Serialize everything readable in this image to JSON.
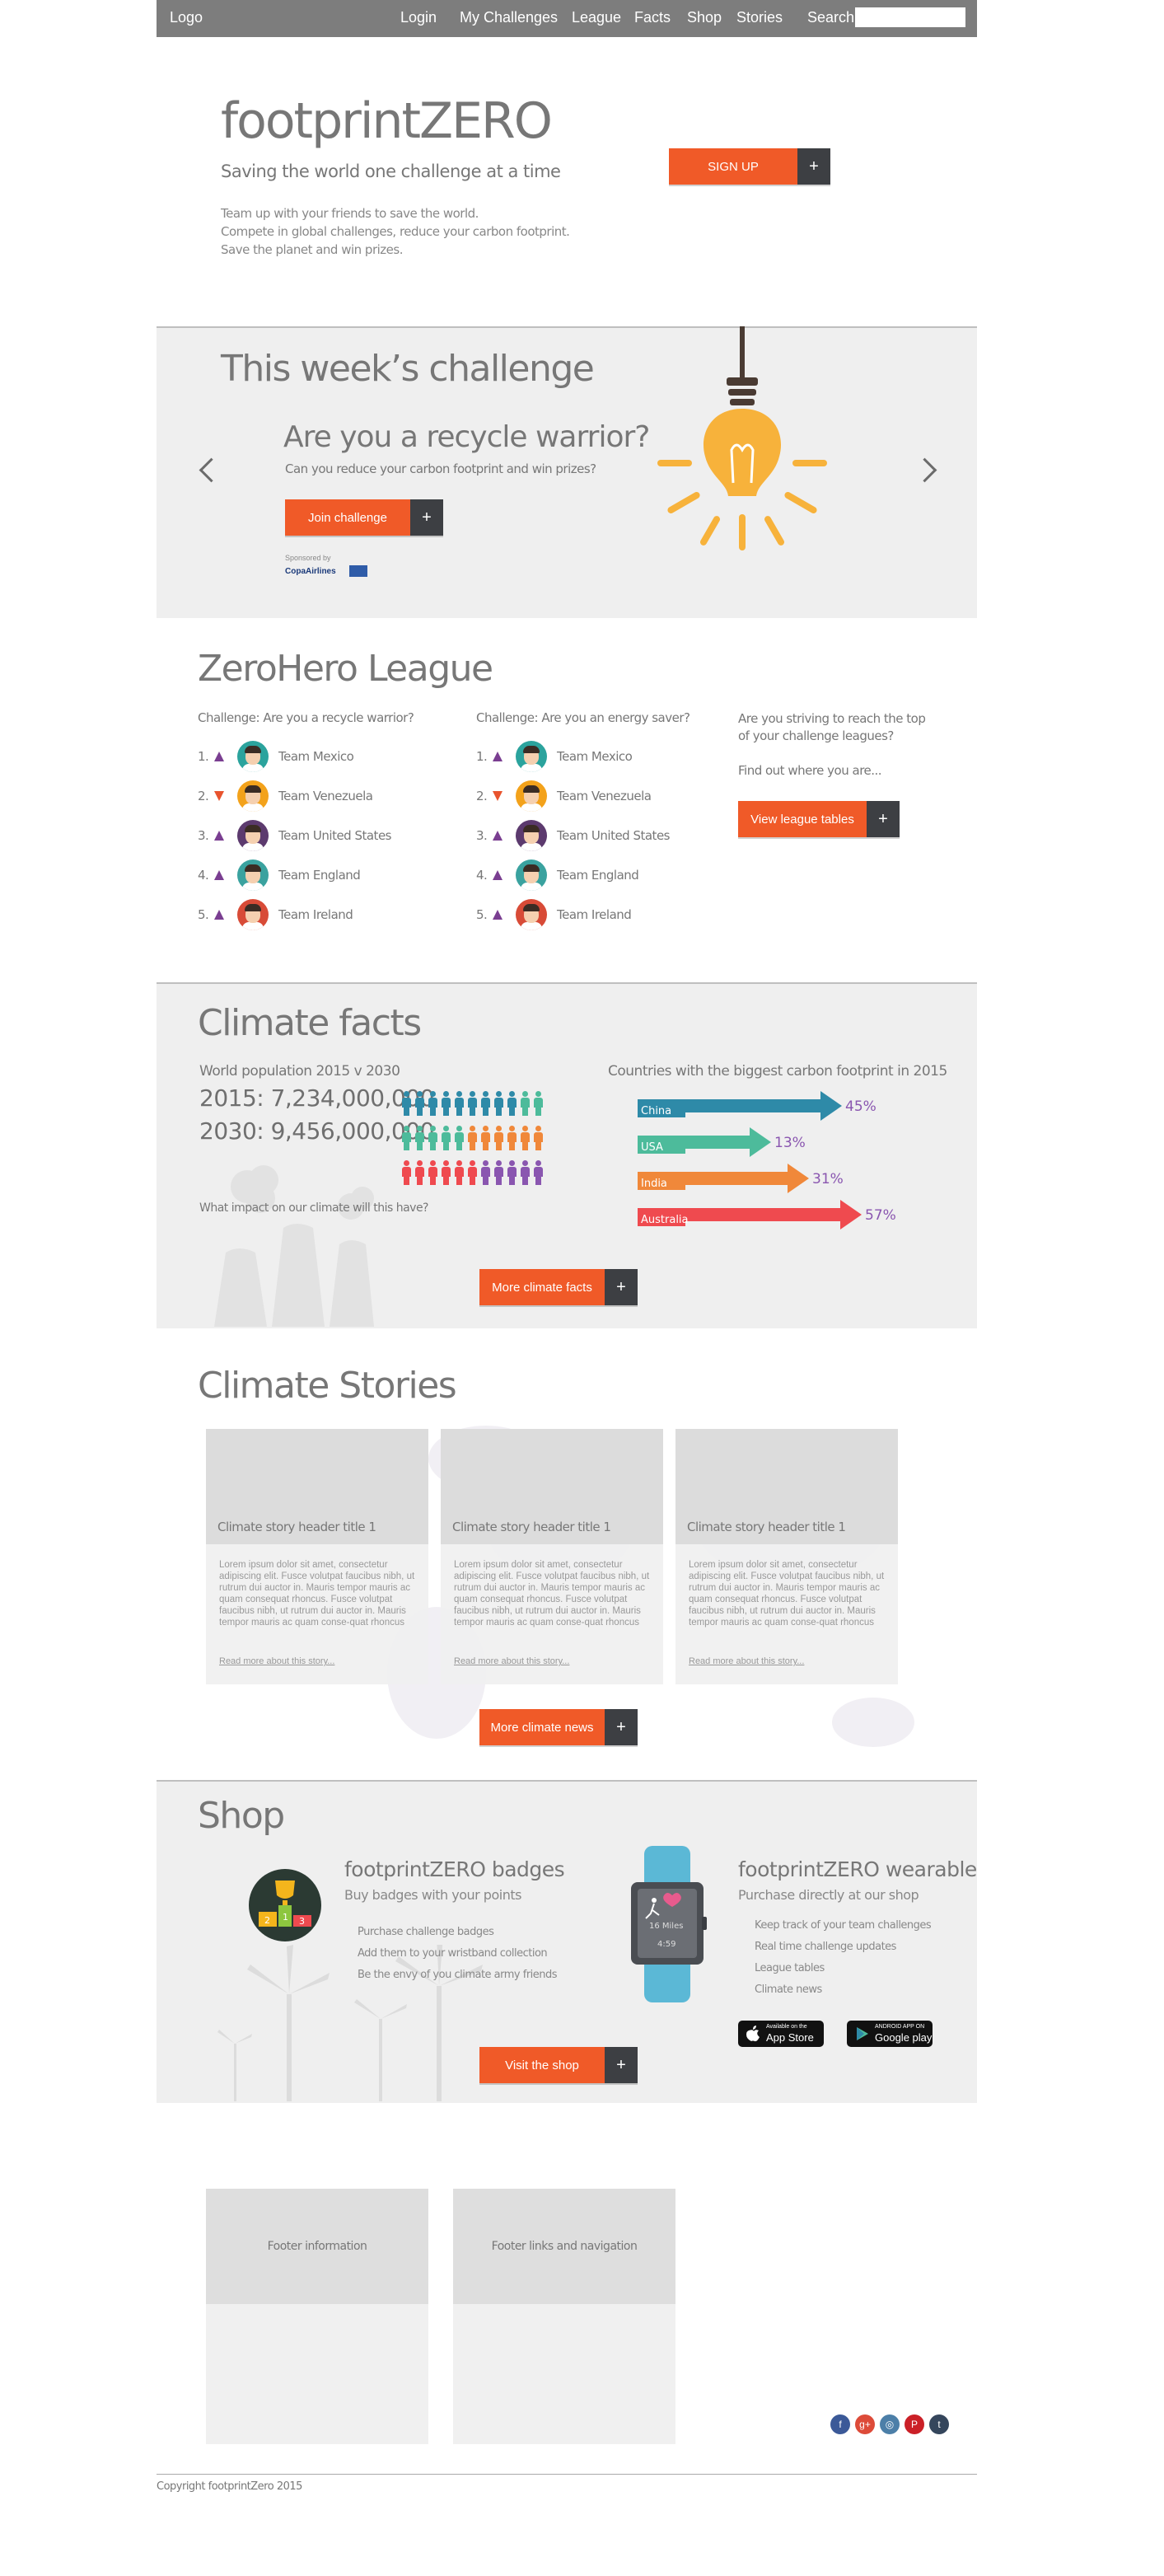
{
  "nav": {
    "logo": "Logo",
    "links": [
      "Login",
      "My Challenges",
      "League",
      "Facts",
      "Shop",
      "Stories"
    ],
    "search_label": "Search",
    "search_value": ""
  },
  "hero": {
    "title": "footprintZERO",
    "tagline": "Saving the world one challenge at a time",
    "body": [
      "Team up with your friends to save the world.",
      "Compete in global challenges, reduce your carbon footprint.",
      "Save the planet and win prizes."
    ],
    "signup": "SIGN UP",
    "plus": "+"
  },
  "challenge": {
    "title": "This week’s challenge",
    "question": "Are you a recycle warrior?",
    "sub": "Can you reduce your carbon footprint and win prizes?",
    "button": "Join challenge",
    "sponsored": "Sponsored by",
    "sponsor": "CopaAirlines"
  },
  "league": {
    "title": "ZeroHero League",
    "tables": [
      {
        "heading": "Challenge: Are you a recycle warrior?",
        "rows": [
          {
            "rank": "1.",
            "trend": "up",
            "team": "Team Mexico",
            "color": "#2ba39d"
          },
          {
            "rank": "2.",
            "trend": "down",
            "team": "Team Venezuela",
            "color": "#f3a21b"
          },
          {
            "rank": "3.",
            "trend": "up",
            "team": "Team United States",
            "color": "#5c3a6e"
          },
          {
            "rank": "4.",
            "trend": "up",
            "team": "Team England",
            "color": "#3aa29f"
          },
          {
            "rank": "5.",
            "trend": "up",
            "team": "Team Ireland",
            "color": "#d84b37"
          }
        ]
      },
      {
        "heading": "Challenge: Are you an energy saver?",
        "rows": [
          {
            "rank": "1.",
            "trend": "up",
            "team": "Team Mexico",
            "color": "#2ba39d"
          },
          {
            "rank": "2.",
            "trend": "down",
            "team": "Team Venezuela",
            "color": "#f3a21b"
          },
          {
            "rank": "3.",
            "trend": "up",
            "team": "Team United States",
            "color": "#5c3a6e"
          },
          {
            "rank": "4.",
            "trend": "up",
            "team": "Team England",
            "color": "#3aa29f"
          },
          {
            "rank": "5.",
            "trend": "up",
            "team": "Team Ireland",
            "color": "#d84b37"
          }
        ]
      }
    ],
    "side_q": [
      "Are you striving to reach the top",
      "of your challenge leagues?"
    ],
    "side_find": "Find out where you are...",
    "button": "View league tables"
  },
  "facts": {
    "title": "Climate facts",
    "pop_label": "World population  2015 v 2030",
    "pop_2015": "2015: 7,234,000,000",
    "pop_2030": "2030: 9,456,000,000",
    "impact": "What impact on our climate will this have?",
    "countries_title": "Countries with the biggest carbon footprint in 2015",
    "countries": [
      {
        "name": "China",
        "value": "45%",
        "color": "#2e8aa8"
      },
      {
        "name": "USA",
        "value": "13%",
        "color": "#4dbb9b"
      },
      {
        "name": "India",
        "value": "31%",
        "color": "#f0883a"
      },
      {
        "name": "Australia",
        "value": "57%",
        "color": "#ef4a4f"
      }
    ],
    "button": "More climate facts"
  },
  "stories": {
    "title": "Climate Stories",
    "items": [
      {
        "header": "Climate story header title 1",
        "text": "Lorem ipsum dolor sit amet, consectetur adipiscing elit. Fusce volutpat faucibus nibh, ut rutrum dui auctor in. Mauris tempor mauris ac quam consequat rhoncus. Fusce volutpat faucibus nibh, ut rutrum dui auctor in. Mauris tempor mauris ac quam conse-quat rhoncus",
        "more": "Read more about this story..."
      },
      {
        "header": "Climate story header title 1",
        "text": "Lorem ipsum dolor sit amet, consectetur adipiscing elit. Fusce volutpat faucibus nibh, ut rutrum dui auctor in. Mauris tempor mauris ac quam consequat rhoncus. Fusce volutpat faucibus nibh, ut rutrum dui auctor in. Mauris tempor mauris ac quam conse-quat rhoncus",
        "more": "Read more about this story..."
      },
      {
        "header": "Climate story header title 1",
        "text": "Lorem ipsum dolor sit amet, consectetur adipiscing elit. Fusce volutpat faucibus nibh, ut rutrum dui auctor in. Mauris tempor mauris ac quam consequat rhoncus. Fusce volutpat faucibus nibh, ut rutrum dui auctor in. Mauris tempor mauris ac quam conse-quat rhoncus",
        "more": "Read more about this story..."
      }
    ],
    "button": "More climate news"
  },
  "shop": {
    "title": "Shop",
    "badges_title": "footprintZERO badges",
    "badges_sub": "Buy badges with your points",
    "badges_list": [
      "Purchase challenge badges",
      "Add them to your wristband collection",
      "Be the envy of you climate army friends"
    ],
    "wear_title": "footprintZERO wearable",
    "wear_sub": "Purchase directly at our shop",
    "wear_list": [
      "Keep track of your team challenges",
      "Real time challenge updates",
      "League tables",
      "Climate news"
    ],
    "watch_distance": "16 Miles",
    "watch_time": "4:59",
    "appstore_small": "Available on the",
    "appstore_big": "App Store",
    "gplay_small": "ANDROID APP ON",
    "gplay_big": "Google play",
    "button": "Visit the shop"
  },
  "footer": {
    "info": "Footer information",
    "links": "Footer links and navigation",
    "copyright": "Copyright footprintZero 2015",
    "social": [
      {
        "name": "facebook",
        "glyph": "f",
        "color": "#3b5998"
      },
      {
        "name": "google-plus",
        "glyph": "g+",
        "color": "#dd4b39"
      },
      {
        "name": "instagram",
        "glyph": "◎",
        "color": "#4c7fa8"
      },
      {
        "name": "pinterest",
        "glyph": "P",
        "color": "#cb2027"
      },
      {
        "name": "tumblr",
        "glyph": "t",
        "color": "#35465c"
      }
    ]
  }
}
